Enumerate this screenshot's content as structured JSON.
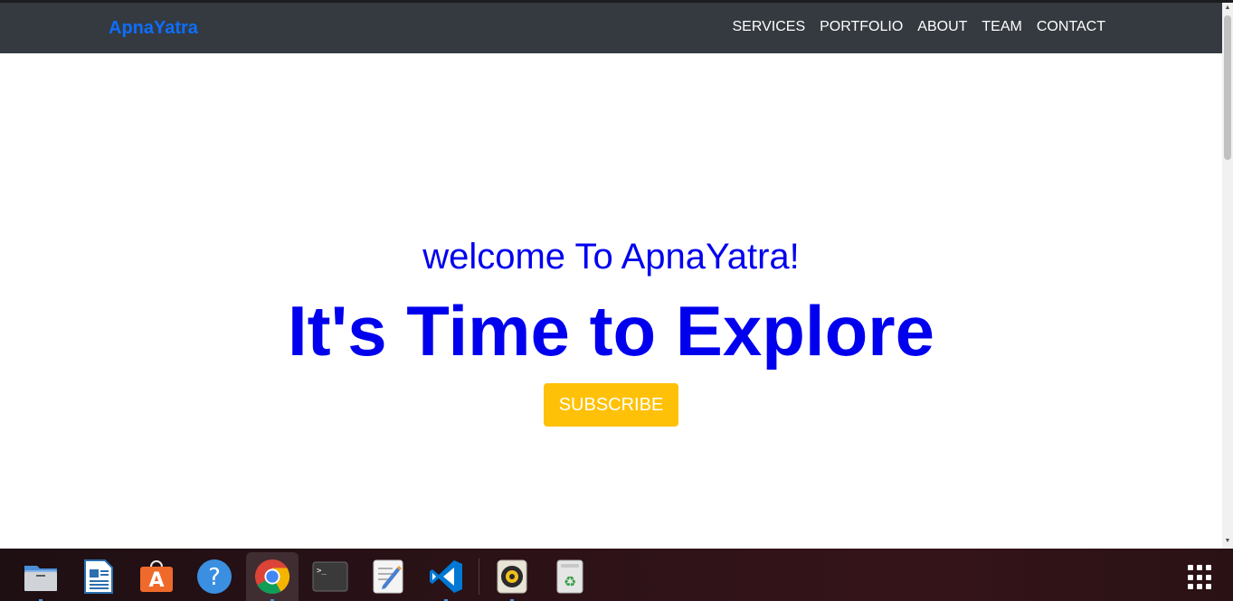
{
  "navbar": {
    "brand": "ApnaYatra",
    "links": [
      "SERVICES",
      "PORTFOLIO",
      "ABOUT",
      "TEAM",
      "CONTACT"
    ]
  },
  "hero": {
    "subtitle": "welcome To ApnaYatra!",
    "title": "It's Time to Explore",
    "button_label": "SUBSCRIBE"
  },
  "colors": {
    "navbar_bg": "#343a40",
    "brand": "#0d6efd",
    "hero_text": "#0000ee",
    "button_bg": "#ffc107"
  },
  "taskbar": {
    "apps": [
      {
        "name": "files-icon",
        "active": false
      },
      {
        "name": "libreoffice-writer-icon",
        "active": false
      },
      {
        "name": "app-store-icon",
        "active": false
      },
      {
        "name": "help-icon",
        "active": false
      },
      {
        "name": "chrome-icon",
        "active": true
      },
      {
        "name": "terminal-icon",
        "active": false
      },
      {
        "name": "text-editor-icon",
        "active": false
      },
      {
        "name": "vscode-icon",
        "active": false
      },
      {
        "name": "rhythmbox-icon",
        "active": false
      },
      {
        "name": "trash-icon",
        "active": false
      }
    ]
  }
}
